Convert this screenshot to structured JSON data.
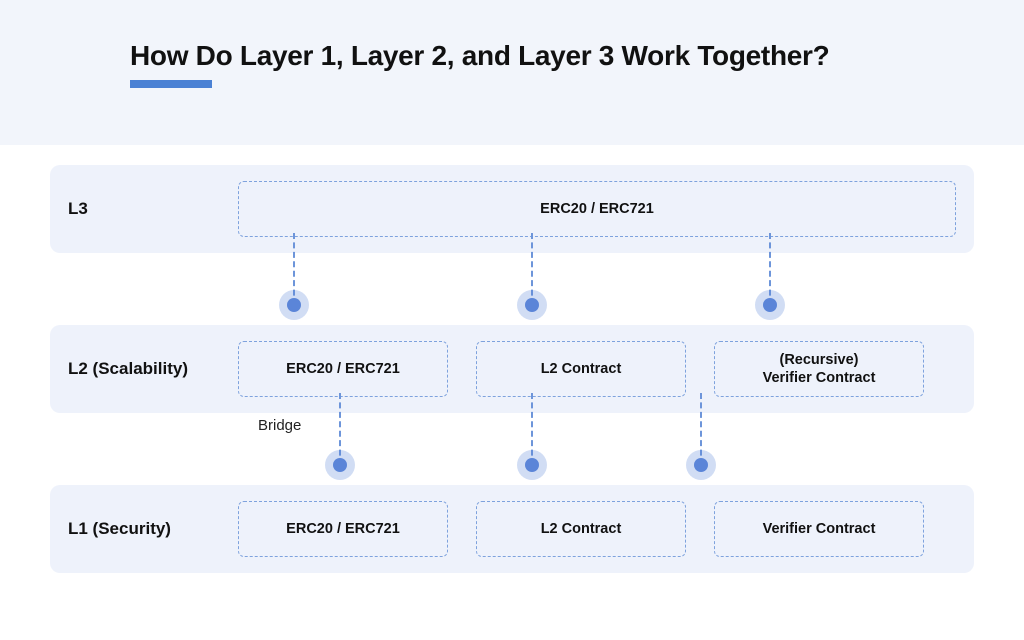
{
  "title": "How Do Layer 1, Layer 2, and Layer 3 Work Together?",
  "bridge_label": "Bridge",
  "layers": {
    "l3": {
      "label": "L3",
      "boxes": {
        "b0": "ERC20 / ERC721"
      }
    },
    "l2": {
      "label": "L2 (Scalability)",
      "boxes": {
        "b0": "ERC20 / ERC721",
        "b1": "L2 Contract",
        "b2": "(Recursive)\nVerifier Contract"
      }
    },
    "l1": {
      "label": "L1 (Security)",
      "boxes": {
        "b0": "ERC20 / ERC721",
        "b1": "L2 Contract",
        "b2": "Verifier Contract"
      }
    }
  }
}
